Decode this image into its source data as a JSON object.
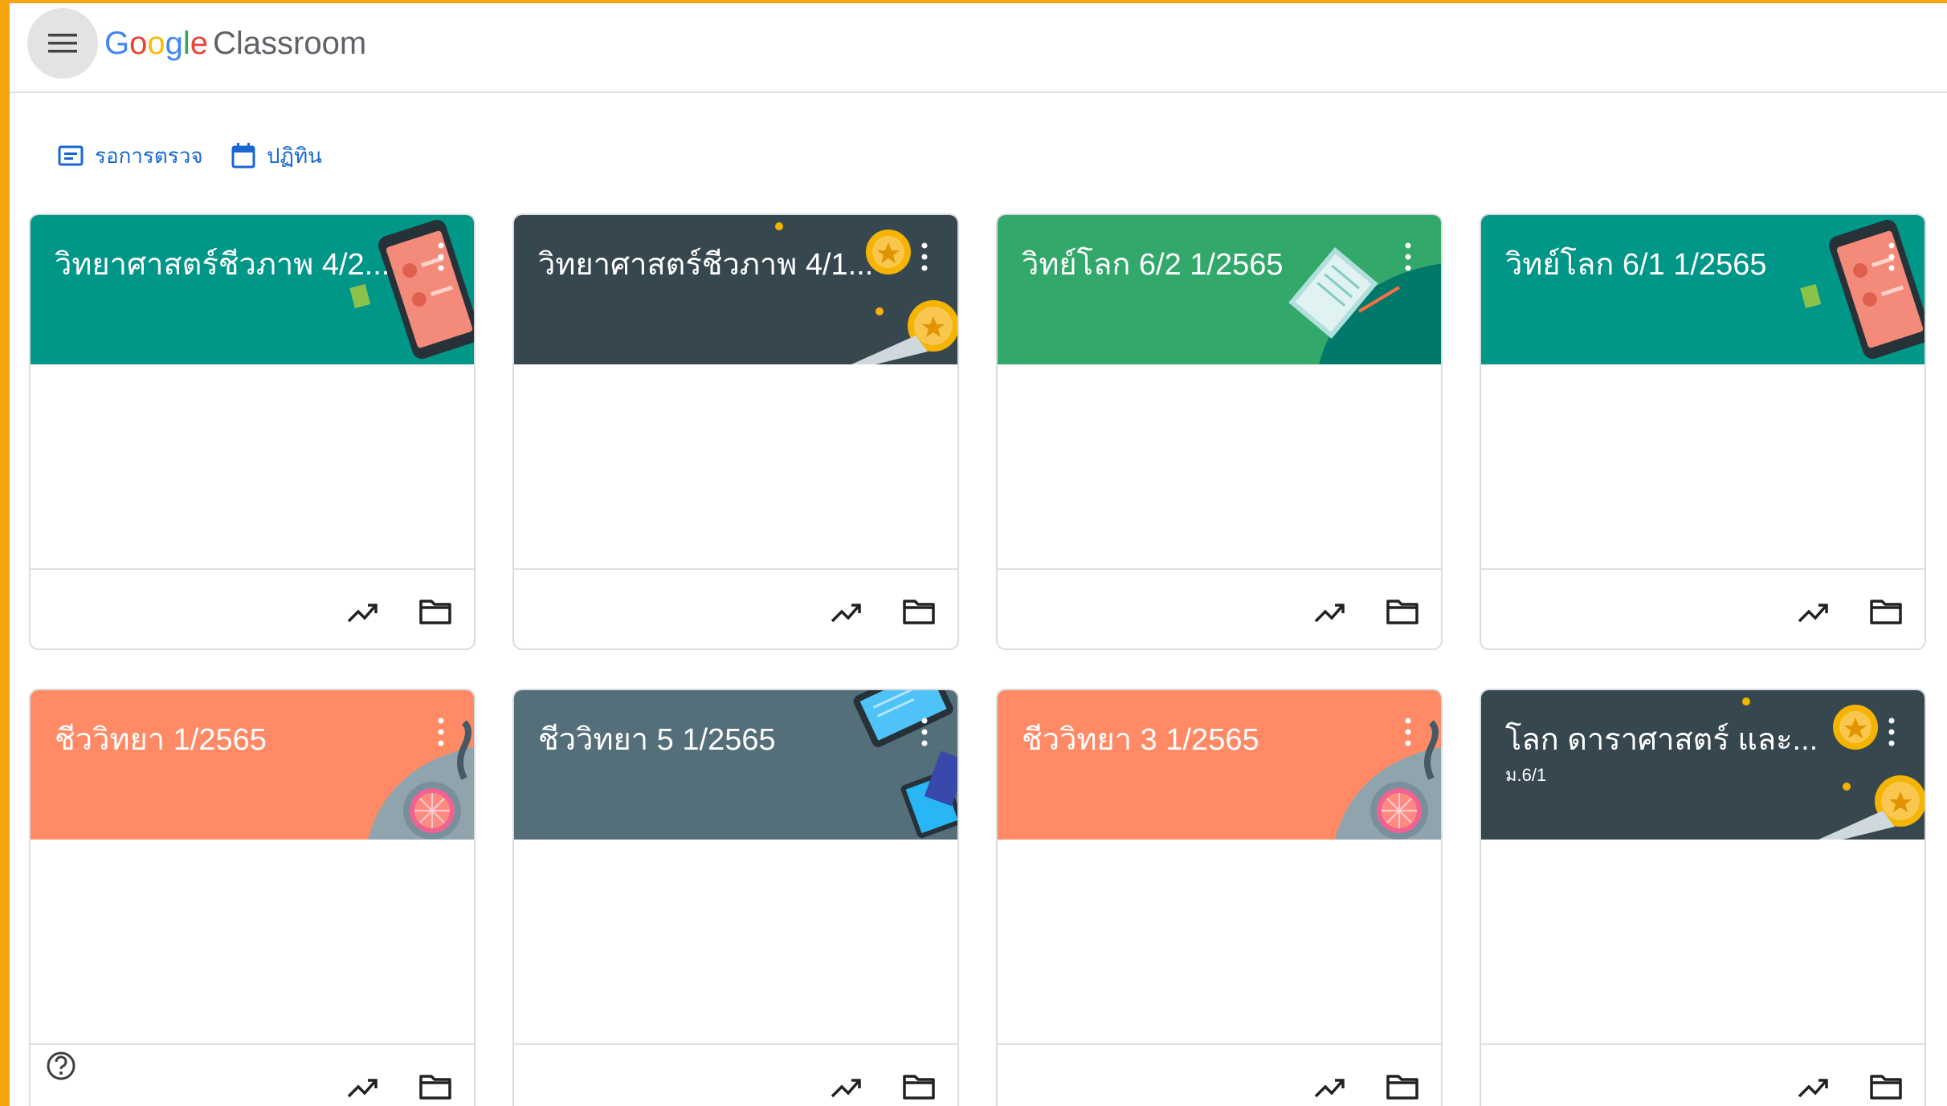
{
  "app": {
    "brand": "Google",
    "product": "Classroom"
  },
  "shortcuts": {
    "todo_label": "รอการตรวจ",
    "calendar_label": "ปฏิทิน"
  },
  "classes": [
    {
      "title": "วิทยาศาสตร์ชีวภาพ 4/2...",
      "subtitle": "",
      "theme": "teal-phone",
      "color": "#009688"
    },
    {
      "title": "วิทยาศาสตร์ชีวภาพ 4/1...",
      "subtitle": "",
      "theme": "dark-medal",
      "color": "#37474f"
    },
    {
      "title": "วิทย์โลก 6/2 1/2565",
      "subtitle": "",
      "theme": "green-book",
      "color": "#33a86b"
    },
    {
      "title": "วิทย์โลก 6/1 1/2565",
      "subtitle": "",
      "theme": "teal-phone",
      "color": "#009688"
    },
    {
      "title": "ชีววิทยา 1/2565",
      "subtitle": "",
      "theme": "orange-lab",
      "color": "#ff8a65"
    },
    {
      "title": "ชีววิทยา 5 1/2565",
      "subtitle": "",
      "theme": "slate-tablet",
      "color": "#546e7a"
    },
    {
      "title": "ชีววิทยา 3 1/2565",
      "subtitle": "",
      "theme": "orange-lab",
      "color": "#ff8a65"
    },
    {
      "title": "โลก ดาราศาสตร์ และ...",
      "subtitle": "ม.6/1",
      "theme": "dark-medal",
      "color": "#37474f"
    }
  ],
  "icons": {
    "menu": "hamburger-icon",
    "todo": "assignment-icon",
    "calendar": "calendar-icon",
    "more": "more-vert-icon",
    "gradebook": "trending-up-icon",
    "folder": "folder-icon",
    "help": "help-icon"
  }
}
